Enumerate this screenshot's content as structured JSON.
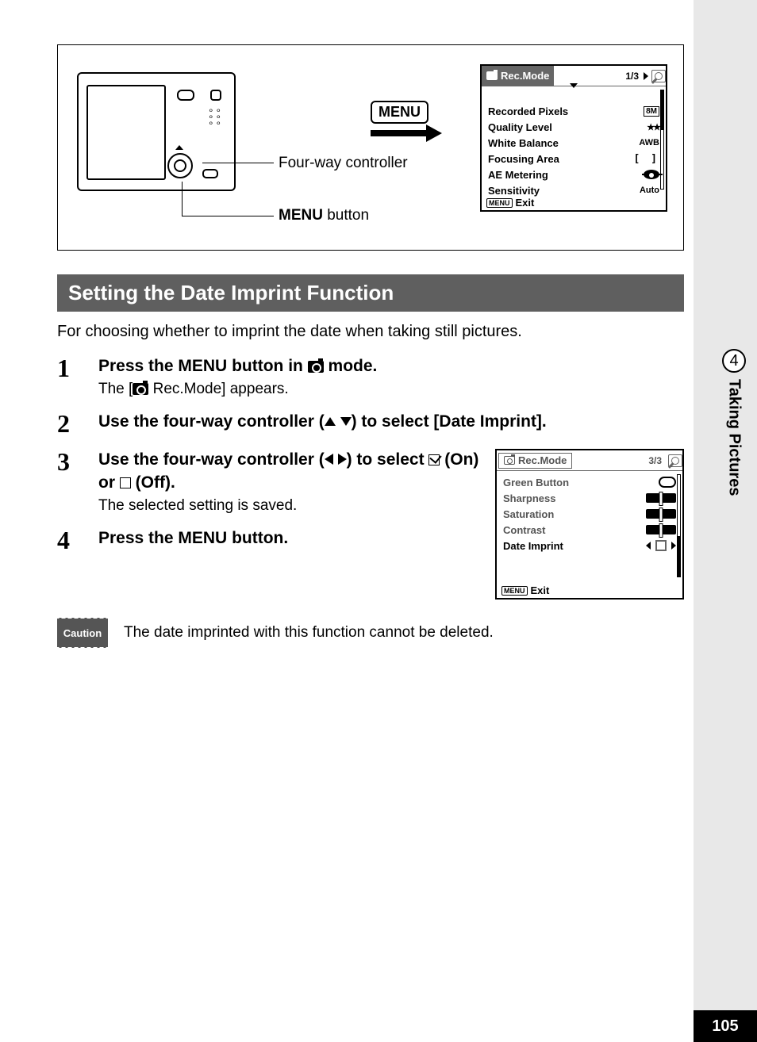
{
  "sidebar": {
    "section_number": "4",
    "section_label": "Taking Pictures"
  },
  "page_number": "105",
  "diagram": {
    "menu_badge": "MENU",
    "fourway_label": "Four-way controller",
    "menu_button_label_bold": "MENU",
    "menu_button_label_rest": " button"
  },
  "lcd1": {
    "tab_title": "Rec.Mode",
    "page_indicator": "1/3",
    "rows": {
      "recorded_pixels": {
        "label": "Recorded Pixels",
        "value": "8M"
      },
      "quality_level": {
        "label": "Quality Level",
        "value": "★★"
      },
      "white_balance": {
        "label": "White Balance",
        "value": "AWB"
      },
      "focusing_area": {
        "label": "Focusing Area"
      },
      "ae_metering": {
        "label": "AE Metering"
      },
      "sensitivity": {
        "label": "Sensitivity",
        "value": "Auto"
      }
    },
    "footer_menu": "MENU",
    "footer_exit": "Exit"
  },
  "heading": "Setting the Date Imprint Function",
  "intro": "For choosing whether to imprint the date when taking still pictures.",
  "steps": {
    "s1": {
      "num": "1",
      "title_a": "Press the ",
      "title_menu": "MENU",
      "title_b": " button in ",
      "title_c": " mode.",
      "sub_a": "The [",
      "sub_b": " Rec.Mode] appears."
    },
    "s2": {
      "num": "2",
      "title_a": "Use the four-way controller (",
      "title_b": ") to select [Date Imprint]."
    },
    "s3": {
      "num": "3",
      "title_a": "Use the four-way controller (",
      "title_b": ") to select ",
      "title_on": " (On) or ",
      "title_off": " (Off).",
      "sub": "The selected setting is saved."
    },
    "s4": {
      "num": "4",
      "title_a": "Press the ",
      "title_menu": "MENU",
      "title_b": " button."
    }
  },
  "lcd2": {
    "tab_title": "Rec.Mode",
    "page_indicator": "3/3",
    "rows": {
      "green_button": {
        "label": "Green Button"
      },
      "sharpness": {
        "label": "Sharpness"
      },
      "saturation": {
        "label": "Saturation"
      },
      "contrast": {
        "label": "Contrast"
      },
      "date_imprint": {
        "label": "Date Imprint"
      }
    },
    "footer_menu": "MENU",
    "footer_exit": "Exit"
  },
  "caution": {
    "badge": "Caution",
    "text": "The date imprinted with this function cannot be deleted."
  }
}
